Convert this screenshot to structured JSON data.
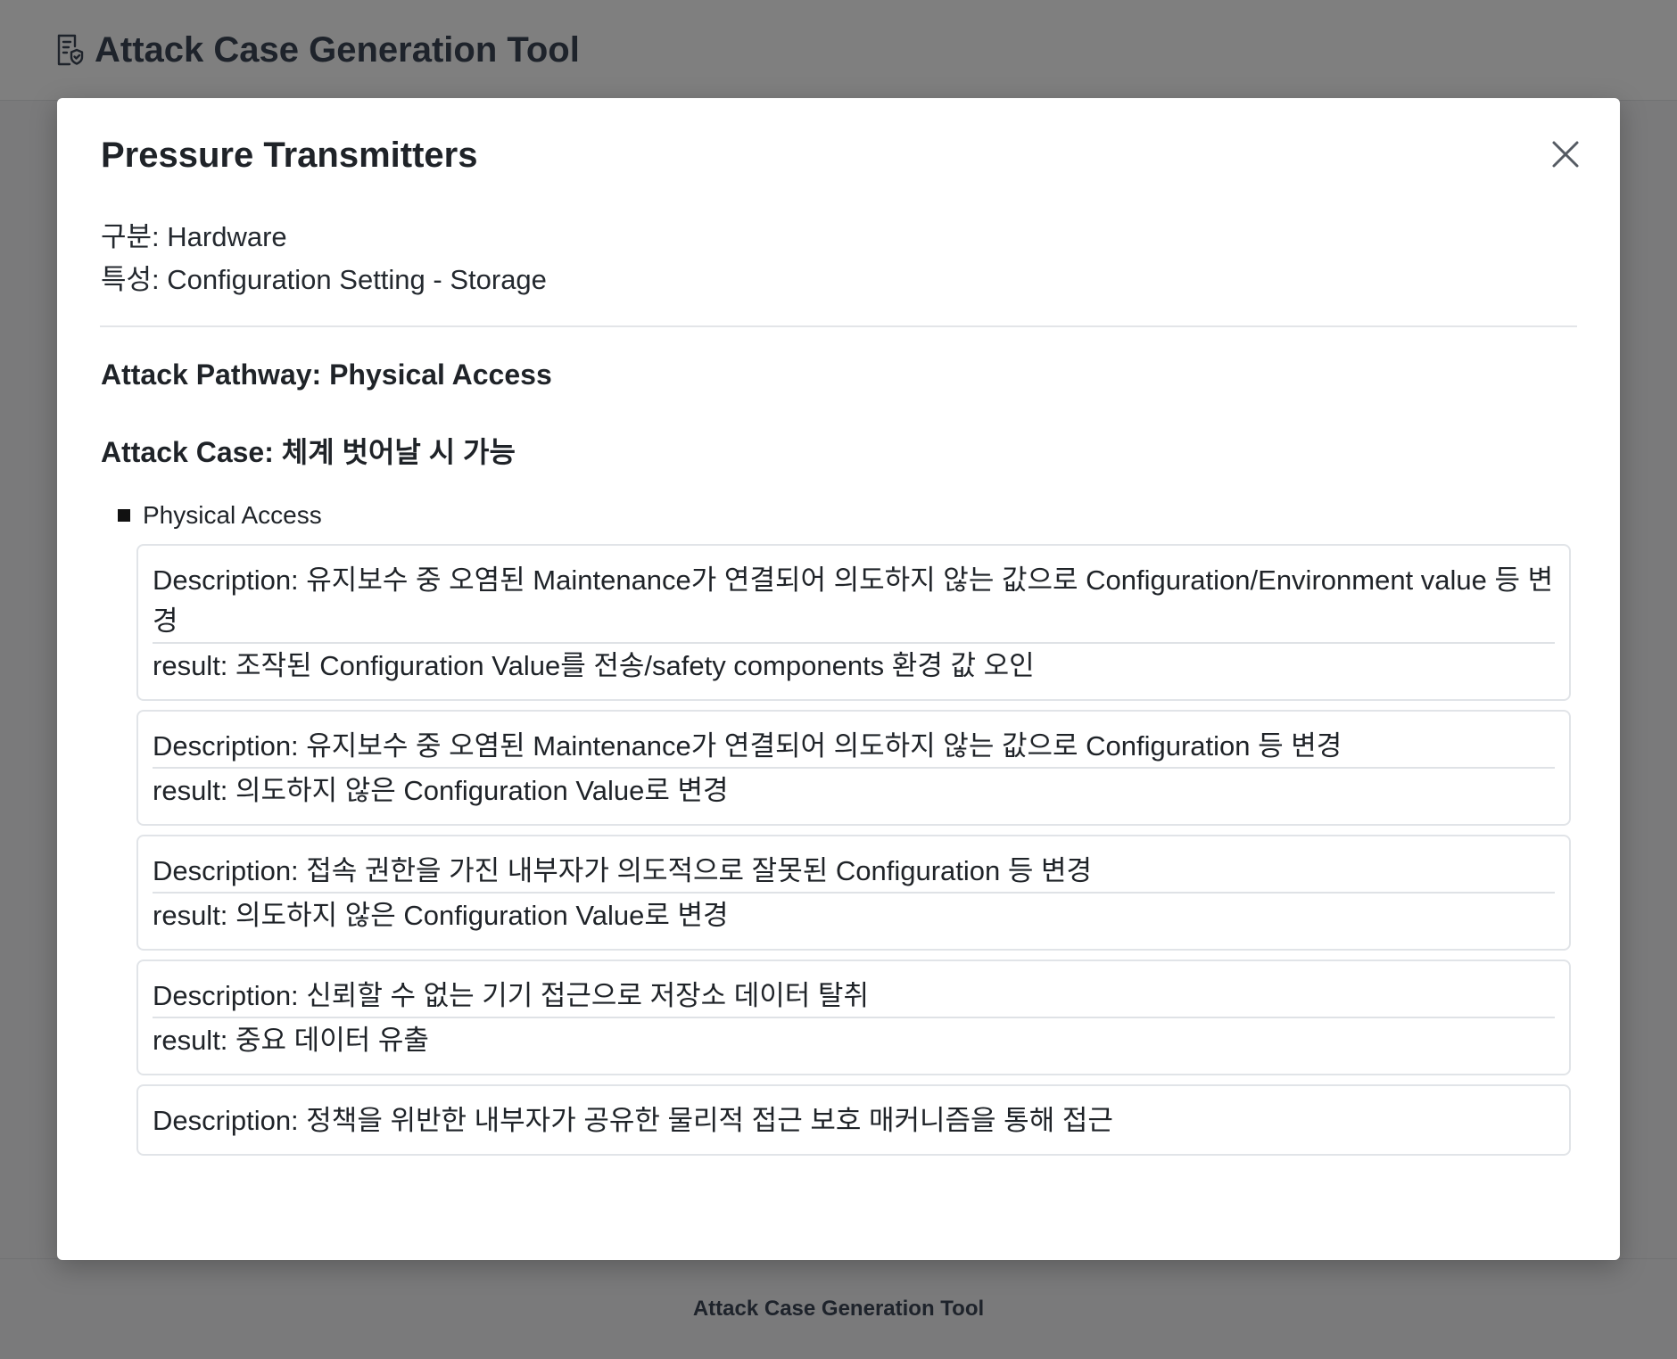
{
  "app": {
    "title": "Attack Case Generation Tool",
    "footer": "Attack Case Generation Tool"
  },
  "modal": {
    "title": "Pressure Transmitters",
    "category_line": "구분: Hardware",
    "property_line": "특성: Configuration Setting - Storage",
    "pathway_label": "Attack Pathway: Physical Access",
    "case_label": "Attack Case: 체계 벗어날 시 가능",
    "group_label": "Physical Access",
    "cards": [
      {
        "description": "Description: 유지보수 중 오염된 Maintenance가 연결되어 의도하지 않는 값으로 Configuration/Environment value 등 변경",
        "result": "result: 조작된 Configuration Value를 전송/safety components 환경 값 오인"
      },
      {
        "description": "Description: 유지보수 중 오염된 Maintenance가 연결되어 의도하지 않는 값으로 Configuration 등 변경",
        "result": "result: 의도하지 않은 Configuration Value로 변경"
      },
      {
        "description": "Description: 접속 권한을 가진 내부자가 의도적으로 잘못된 Configuration 등 변경",
        "result": "result: 의도하지 않은 Configuration Value로 변경"
      },
      {
        "description": "Description: 신뢰할 수 없는 기기 접근으로 저장소 데이터 탈취",
        "result": "result: 중요 데이터 유출"
      },
      {
        "description": "Description: 정책을 위반한 내부자가 공유한 물리적 접근 보호 매커니즘을 통해 접근"
      }
    ]
  },
  "icons": {
    "app_icon": "document-shield-icon",
    "close": "close-icon"
  }
}
